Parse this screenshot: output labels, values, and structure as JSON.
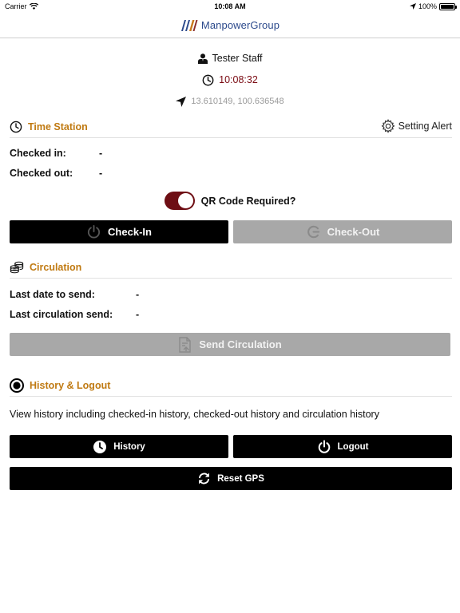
{
  "status_bar": {
    "carrier": "Carrier",
    "time": "10:08 AM",
    "battery": "100%"
  },
  "navbar": {
    "brand": "ManpowerGroup",
    "brand_colors": [
      "#2c4a8c",
      "#c97a1f",
      "#8a2d2d"
    ]
  },
  "user": {
    "name": "Tester Staff",
    "clock": "10:08:32",
    "gps": "13.610149, 100.636548"
  },
  "time_station": {
    "title": "Time Station",
    "setting_alert": "Setting Alert",
    "checked_in_label": "Checked in:",
    "checked_in_value": "-",
    "checked_out_label": "Checked out:",
    "checked_out_value": "-",
    "qr_label": "QR Code Required?",
    "qr_enabled": true,
    "checkin_label": "Check-In",
    "checkout_label": "Check-Out"
  },
  "circulation": {
    "title": "Circulation",
    "last_date_label": "Last date to send:",
    "last_date_value": "-",
    "last_send_label": "Last circulation send:",
    "last_send_value": "-",
    "send_label": "Send Circulation"
  },
  "history_logout": {
    "title": "History & Logout",
    "description": "View history including checked-in history, checked-out history and circulation history",
    "history_label": "History",
    "logout_label": "Logout",
    "reset_gps_label": "Reset GPS"
  },
  "colors": {
    "accent": "#c07a12",
    "clock": "#7a0a12",
    "toggle": "#6e0e14",
    "disabled": "#a8a8a8"
  }
}
